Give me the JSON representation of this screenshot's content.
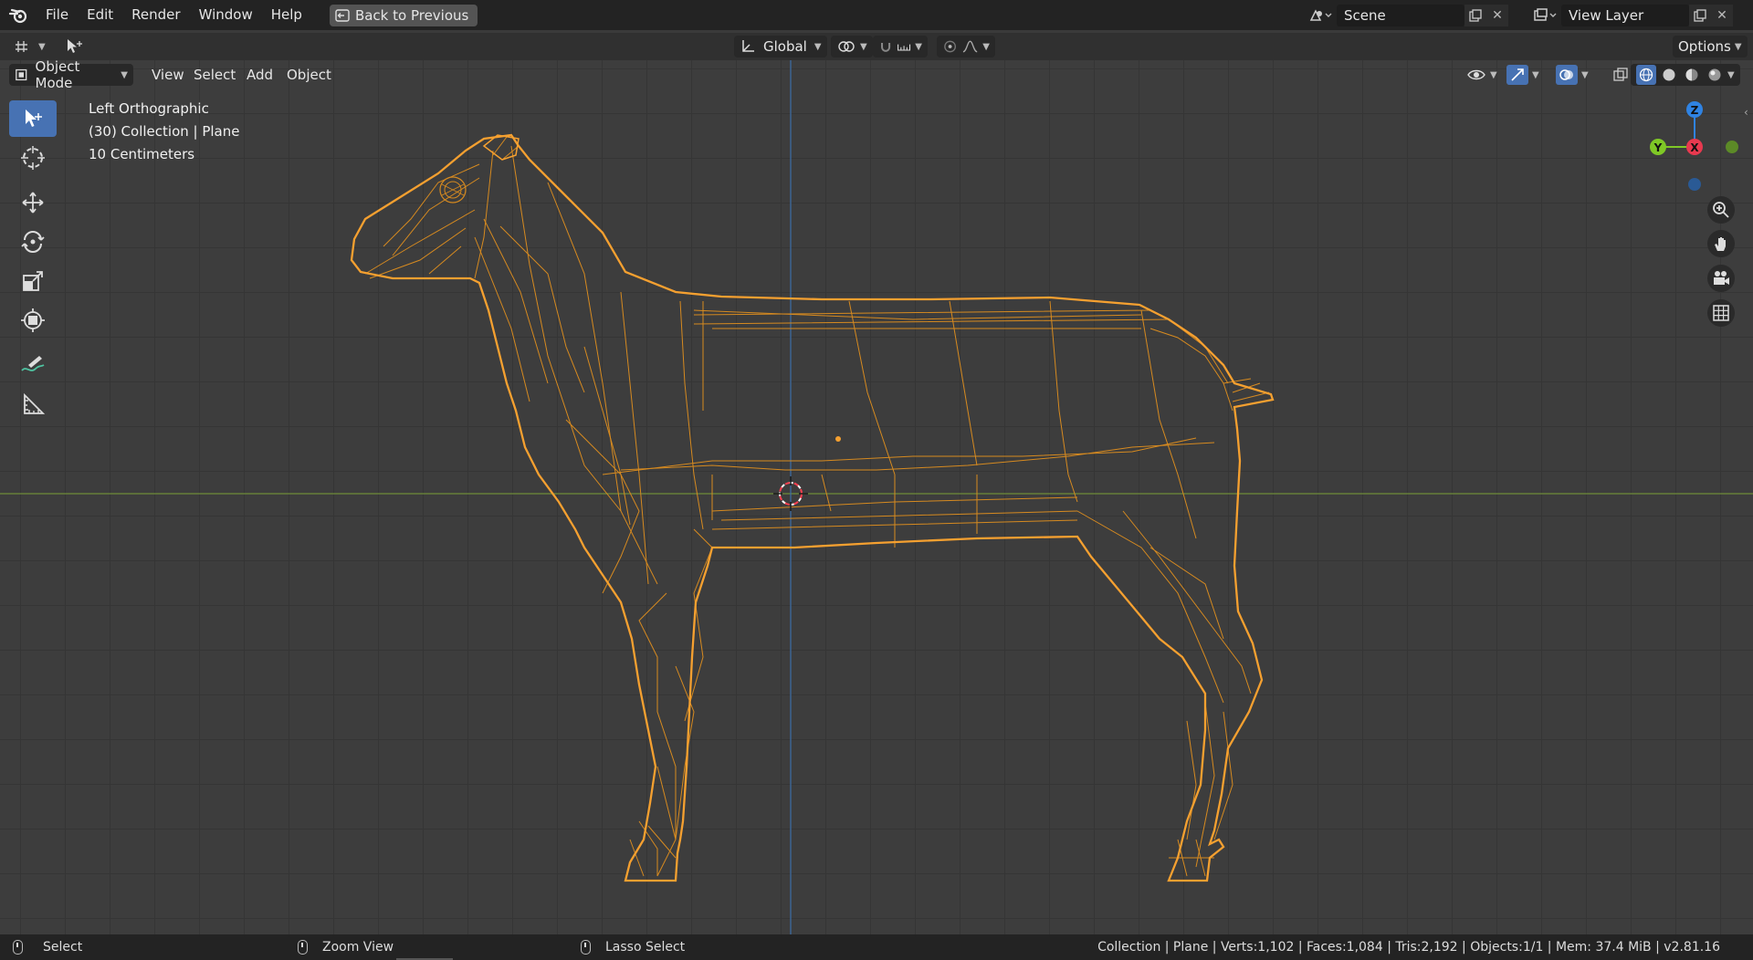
{
  "topbar": {
    "menus": [
      "File",
      "Edit",
      "Render",
      "Window",
      "Help"
    ],
    "back_button": "Back to Previous",
    "scene": "Scene",
    "view_layer": "View Layer"
  },
  "header": {
    "transform_orientation": "Global",
    "options": "Options"
  },
  "viewport_header": {
    "mode": "Object Mode",
    "menus": [
      "View",
      "Select",
      "Add",
      "Object"
    ]
  },
  "overlay": {
    "view_name": "Left Orthographic",
    "collection": "(30) Collection | Plane",
    "scale": "10 Centimeters"
  },
  "gizmo": {
    "z": "Z",
    "y": "Y",
    "x": "X"
  },
  "statusbar": {
    "left": "Select",
    "middle": "Zoom View",
    "right": "Lasso Select",
    "stats": "Collection | Plane | Verts:1,102 | Faces:1,084 | Tris:2,192 | Objects:1/1 | Mem: 37.4 MiB | v2.81.16"
  },
  "colors": {
    "selection": "#f5a030",
    "active_tool": "#4772b3",
    "axis_x": "#e8394f",
    "axis_y": "#7fc826",
    "axis_z": "#2f83e3"
  }
}
